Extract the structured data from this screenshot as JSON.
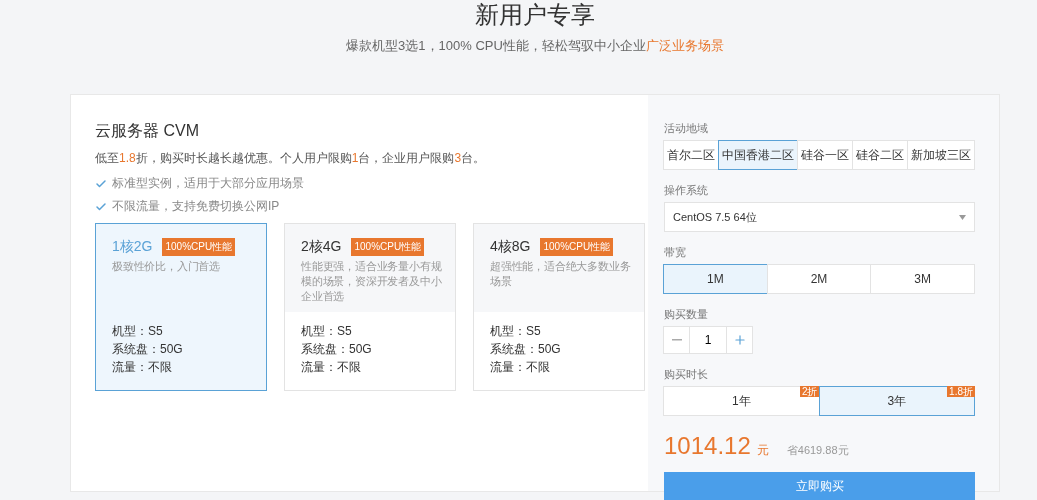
{
  "header": {
    "title": "新用户专享",
    "subtitle": [
      {
        "text": "爆款机型3选1，100% CPU性能，轻松驾驭中小企业",
        "accent": false
      },
      {
        "text": "广泛业务场景",
        "accent": true
      }
    ]
  },
  "product": {
    "title": "云服务器 CVM",
    "note": [
      {
        "text": "低至",
        "accent": false
      },
      {
        "text": "1.8",
        "accent": true
      },
      {
        "text": "折，购买时长越长越优惠。个人用户限购",
        "accent": false
      },
      {
        "text": "1",
        "accent": true
      },
      {
        "text": "台，企业用户限购",
        "accent": false
      },
      {
        "text": "3",
        "accent": true
      },
      {
        "text": "台。",
        "accent": false
      }
    ],
    "features": [
      "标准型实例，适用于大部分应用场景",
      "不限流量，支持免费切换公网IP"
    ],
    "plans": [
      {
        "name": "1核2G",
        "badge": "100%CPU性能",
        "description": "极致性价比，入门首选",
        "specs": [
          "机型：S5",
          "系统盘：50G",
          "流量：不限"
        ],
        "selected": true
      },
      {
        "name": "2核4G",
        "badge": "100%CPU性能",
        "description": "性能更强，适合业务量小有规模的场景，资深开发者及中小企业首选",
        "specs": [
          "机型：S5",
          "系统盘：50G",
          "流量：不限"
        ],
        "selected": false
      },
      {
        "name": "4核8G",
        "badge": "100%CPU性能",
        "description": "超强性能，适合绝大多数业务场景",
        "specs": [
          "机型：S5",
          "系统盘：50G",
          "流量：不限"
        ],
        "selected": false
      }
    ]
  },
  "config": {
    "region": {
      "label": "活动地域",
      "options": [
        {
          "label": "首尔二区",
          "selected": false
        },
        {
          "label": "中国香港二区",
          "selected": true
        },
        {
          "label": "硅谷一区",
          "selected": false
        },
        {
          "label": "硅谷二区",
          "selected": false
        },
        {
          "label": "新加坡三区",
          "selected": false
        }
      ]
    },
    "os": {
      "label": "操作系统",
      "value": "CentOS 7.5 64位"
    },
    "bandwidth": {
      "label": "带宽",
      "options": [
        {
          "label": "1M",
          "selected": true
        },
        {
          "label": "2M",
          "selected": false
        },
        {
          "label": "3M",
          "selected": false
        }
      ]
    },
    "quantity": {
      "label": "购买数量",
      "value": "1"
    },
    "duration": {
      "label": "购买时长",
      "options": [
        {
          "label": "1年",
          "discount": "2折",
          "selected": false
        },
        {
          "label": "3年",
          "discount": "1.8折",
          "selected": true
        }
      ]
    },
    "price": {
      "amount": "1014.12",
      "unit": "元",
      "saving": "省4619.88元"
    },
    "buy_button": "立即购买"
  }
}
